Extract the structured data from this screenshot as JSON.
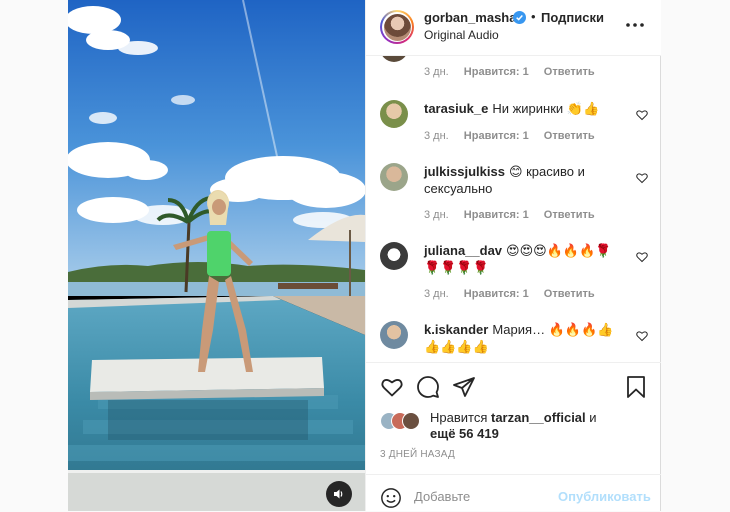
{
  "post": {
    "author": "gorban_masha",
    "separator": "•",
    "follow_label": "Подписки",
    "audio_label": "Original Audio",
    "verified_icon": "verified-badge-icon",
    "more_icon": "more-options-icon",
    "mute_icon": "speaker-icon"
  },
  "comments": [
    {
      "username": "",
      "text": "",
      "time": "3 дн.",
      "likes": "Нравится: 1",
      "reply": "Ответить"
    },
    {
      "username": "tarasiuk_e",
      "text": "Ни жиринки 👏👍",
      "time": "3 дн.",
      "likes": "Нравится: 1",
      "reply": "Ответить"
    },
    {
      "username": "julkissjulkiss",
      "text": "😊 красиво и сексуально",
      "time": "3 дн.",
      "likes": "Нравится: 1",
      "reply": "Ответить"
    },
    {
      "username": "juliana__dav",
      "text": "😍😍😍🔥🔥🔥🌹🌹🌹🌹🌹",
      "time": "3 дн.",
      "likes": "Нравится: 1",
      "reply": "Ответить"
    },
    {
      "username": "k.iskander",
      "text": "Мария… 🔥🔥🔥👍👍👍👍👍",
      "time": "",
      "likes": "",
      "reply": ""
    }
  ],
  "actions": {
    "like_icon": "heart-icon",
    "comment_icon": "comment-icon",
    "share_icon": "send-icon",
    "save_icon": "bookmark-icon"
  },
  "likes": {
    "prefix": "Нравится",
    "user": "tarzan__official",
    "conjunction": "и",
    "others": "ещё 56 419"
  },
  "date": "3 ДНЕЙ НАЗАД",
  "add_comment": {
    "placeholder": "Добавьте",
    "post_label": "Опубликовать",
    "emoji_icon": "emoji-icon"
  },
  "colors": {
    "border": "#dbdbdb",
    "meta_text": "#8e8e8e",
    "post_button_disabled": "#b2dffc",
    "verified_blue": "#3897f0"
  }
}
